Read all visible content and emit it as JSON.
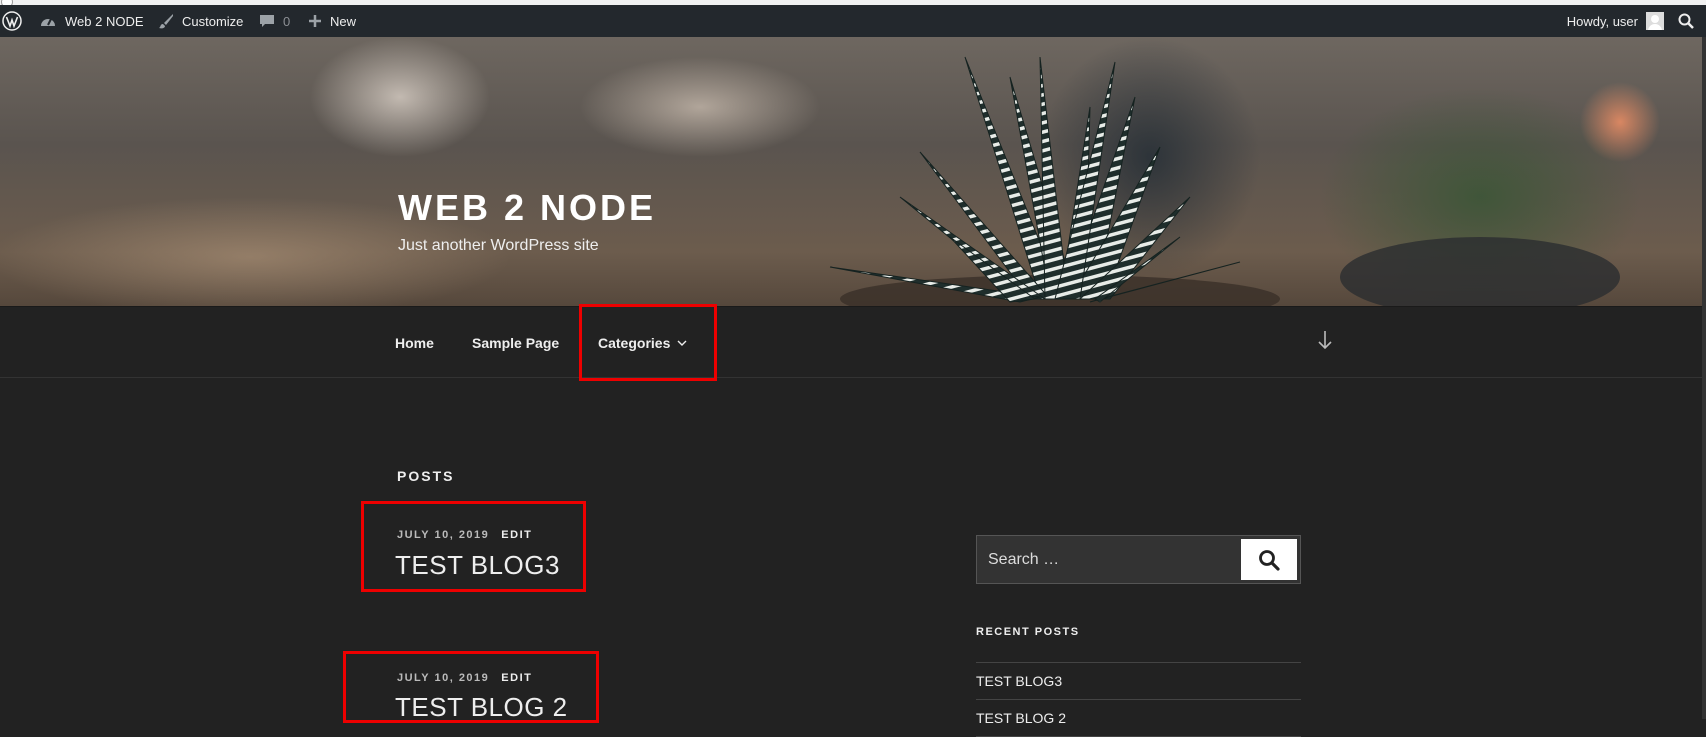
{
  "admin_bar": {
    "site_name": "Web 2 NODE",
    "customize_label": "Customize",
    "comments_count": "0",
    "new_label": "New",
    "howdy_label": "Howdy, user"
  },
  "header": {
    "site_title": "WEB 2 NODE",
    "site_description": "Just another WordPress site"
  },
  "nav": {
    "items": [
      {
        "label": "Home"
      },
      {
        "label": "Sample Page"
      },
      {
        "label": "Categories"
      }
    ]
  },
  "content": {
    "posts_heading": "POSTS",
    "posts": [
      {
        "date": "JULY 10, 2019",
        "edit_label": "EDIT",
        "title": "TEST BLOG3"
      },
      {
        "date": "JULY 10, 2019",
        "edit_label": "EDIT",
        "title": "TEST BLOG 2"
      }
    ]
  },
  "sidebar": {
    "search_placeholder": "Search …",
    "recent_posts_heading": "RECENT POSTS",
    "recent_posts": [
      {
        "title": "TEST BLOG3"
      },
      {
        "title": "TEST BLOG 2"
      }
    ]
  },
  "colors": {
    "admin_bar": "#23282d",
    "background": "#222222",
    "highlight": "#ee0000"
  }
}
